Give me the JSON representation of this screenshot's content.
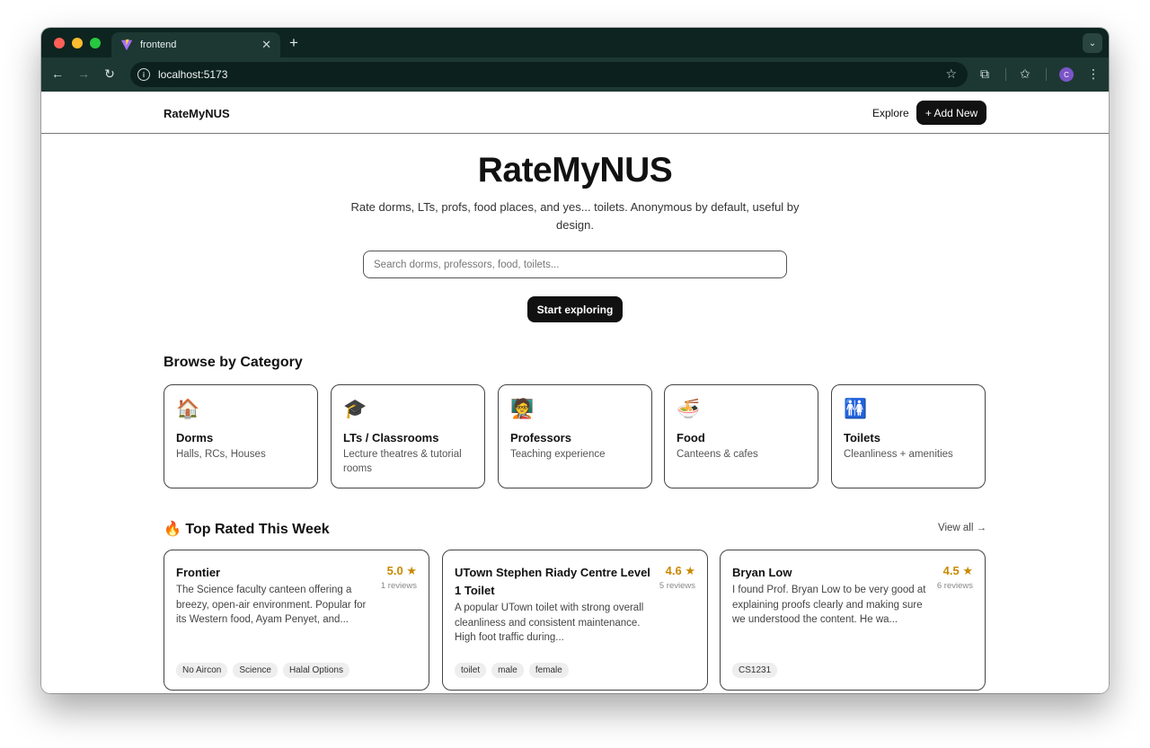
{
  "browser": {
    "tab_title": "frontend",
    "url": "localhost:5173",
    "profile_initial": "C"
  },
  "site": {
    "brand": "RateMyNUS",
    "nav_explore": "Explore",
    "add_new": "+ Add New"
  },
  "hero": {
    "title": "RateMyNUS",
    "subtitle": "Rate dorms, LTs, profs, food places, and yes... toilets. Anonymous by default, useful by design.",
    "search_placeholder": "Search dorms, professors, food, toilets...",
    "cta": "Start exploring"
  },
  "categories": {
    "title": "Browse by Category",
    "items": [
      {
        "emoji": "🏠",
        "name": "Dorms",
        "desc": "Halls, RCs, Houses"
      },
      {
        "emoji": "🎓",
        "name": "LTs / Classrooms",
        "desc": "Lecture theatres & tutorial rooms"
      },
      {
        "emoji": "🧑‍🏫",
        "name": "Professors",
        "desc": "Teaching experience"
      },
      {
        "emoji": "🍜",
        "name": "Food",
        "desc": "Canteens & cafes"
      },
      {
        "emoji": "🚻",
        "name": "Toilets",
        "desc": "Cleanliness + amenities"
      }
    ]
  },
  "top_rated": {
    "title": "🔥 Top Rated This Week",
    "view_all": "View all →",
    "items": [
      {
        "name": "Frontier",
        "score": "5.0 ★",
        "reviews": "1 reviews",
        "desc": "The Science faculty canteen offering a breezy, open-air environment. Popular for its Western food, Ayam Penyet, and...",
        "tags": [
          "No Aircon",
          "Science",
          "Halal Options"
        ]
      },
      {
        "name": "UTown Stephen Riady Centre Level 1 Toilet",
        "score": "4.6 ★",
        "reviews": "5 reviews",
        "desc": "A popular UTown toilet with strong overall cleanliness and consistent maintenance. High foot traffic during...",
        "tags": [
          "toilet",
          "male",
          "female"
        ]
      },
      {
        "name": "Bryan Low",
        "score": "4.5 ★",
        "reviews": "6 reviews",
        "desc": "I found Prof. Bryan Low to be very good at explaining proofs clearly and making sure we understood the content. He wa...",
        "tags": [
          "CS1231"
        ]
      }
    ]
  },
  "colors": {
    "chrome_dark": "#0d2420",
    "chrome_mid": "#1d3833",
    "accent_black": "#111111",
    "rating_gold": "#c88a00"
  }
}
